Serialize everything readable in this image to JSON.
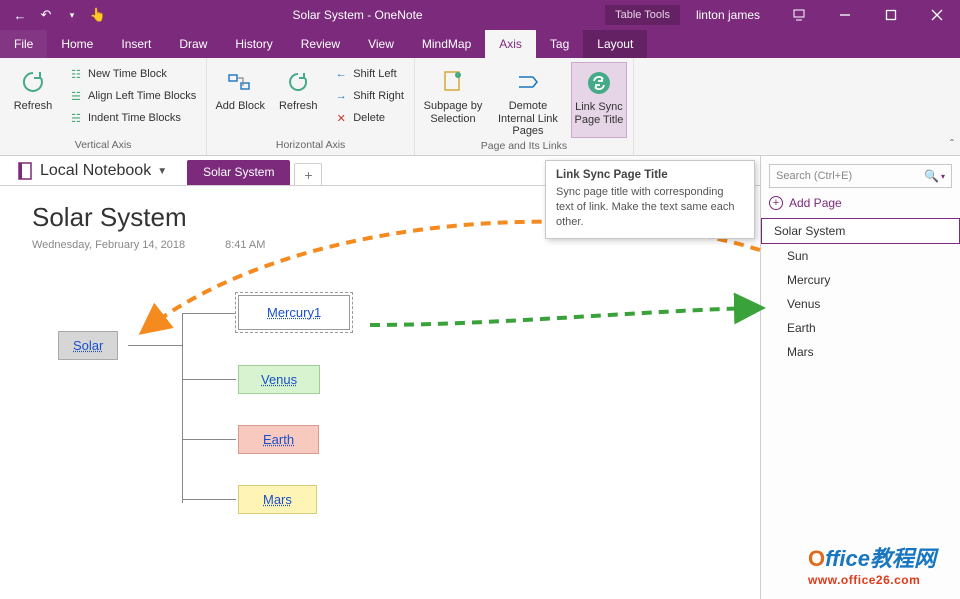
{
  "titlebar": {
    "title": "Solar System  -  OneNote",
    "tool_tab": "Table Tools",
    "user": "linton james"
  },
  "tabs": {
    "file": "File",
    "home": "Home",
    "insert": "Insert",
    "draw": "Draw",
    "history": "History",
    "review": "Review",
    "view": "View",
    "mindmap": "MindMap",
    "axis": "Axis",
    "tag": "Tag",
    "layout": "Layout"
  },
  "ribbon": {
    "refresh": "Refresh",
    "vertical": {
      "new_block": "New Time Block",
      "align": "Align Left Time Blocks",
      "indent": "Indent Time Blocks",
      "group": "Vertical Axis"
    },
    "horizontal": {
      "add_block": "Add Block",
      "refresh": "Refresh",
      "shift_left": "Shift Left",
      "shift_right": "Shift Right",
      "delete": "Delete",
      "group": "Horizontal Axis"
    },
    "links": {
      "subpage": "Subpage by Selection",
      "demote": "Demote Internal Link Pages",
      "sync": "Link Sync Page Title",
      "group": "Page and Its Links"
    }
  },
  "tooltip": {
    "title": "Link Sync Page Title",
    "body": "Sync page title with corresponding text of link. Make the text same each other."
  },
  "notebook": {
    "title": "Local Notebook",
    "tab": "Solar System"
  },
  "page": {
    "title": "Solar System",
    "date": "Wednesday, February 14, 2018",
    "time": "8:41 AM"
  },
  "nodes": {
    "root": "Solar",
    "mercury": "Mercury1",
    "venus": "Venus",
    "earth": "Earth",
    "mars": "Mars"
  },
  "search": {
    "placeholder": "Search (Ctrl+E)"
  },
  "add_page": "Add Page",
  "pages": [
    {
      "label": "Solar System",
      "selected": true,
      "child": false
    },
    {
      "label": "Sun",
      "selected": false,
      "child": true
    },
    {
      "label": "Mercury",
      "selected": false,
      "child": true
    },
    {
      "label": "Venus",
      "selected": false,
      "child": true
    },
    {
      "label": "Earth",
      "selected": false,
      "child": true
    },
    {
      "label": "Mars",
      "selected": false,
      "child": true
    }
  ],
  "watermark": {
    "brand_o": "O",
    "brand_rest": "ffice教程网",
    "url": "www.office26.com"
  }
}
